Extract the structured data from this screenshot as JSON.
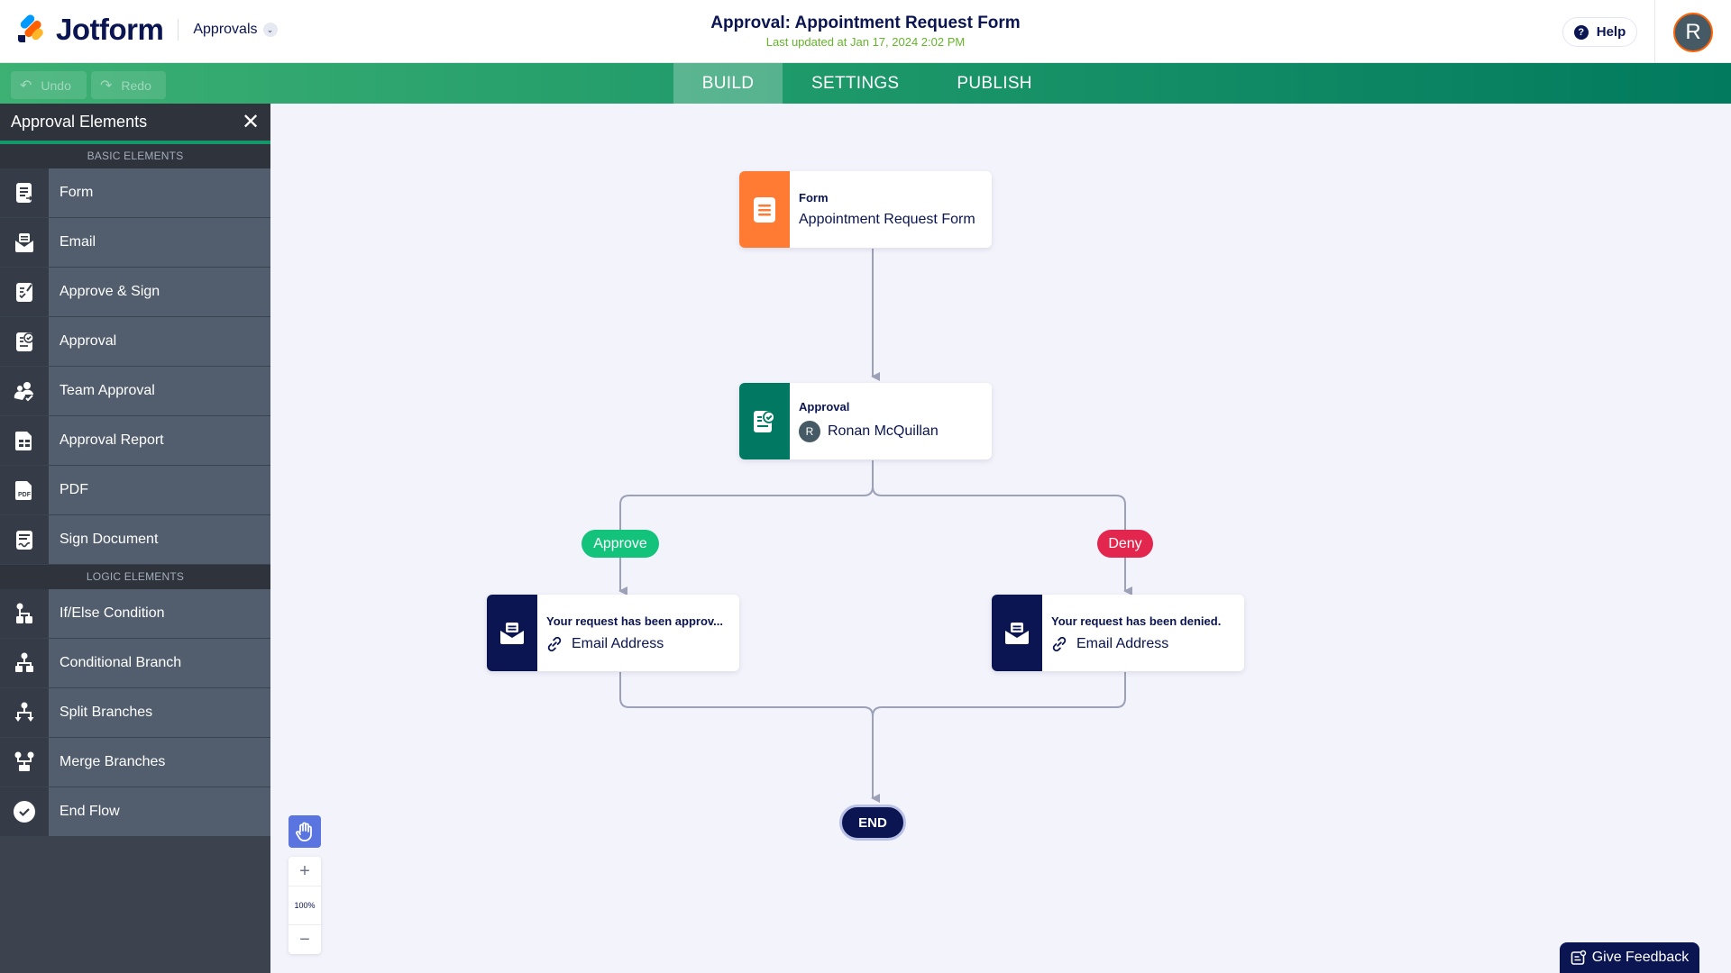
{
  "header": {
    "brand": "Jotform",
    "product": "Approvals",
    "title": "Approval: Appointment Request Form",
    "last_updated": "Last updated at Jan 17, 2024 2:02 PM",
    "help_label": "Help",
    "avatar_initial": "R"
  },
  "toolbar": {
    "undo_label": "Undo",
    "redo_label": "Redo"
  },
  "tabs": [
    {
      "label": "BUILD",
      "active": true
    },
    {
      "label": "SETTINGS",
      "active": false
    },
    {
      "label": "PUBLISH",
      "active": false
    }
  ],
  "sidebar": {
    "title": "Approval Elements",
    "close_icon": "close-icon",
    "sections": [
      {
        "title": "BASIC ELEMENTS",
        "items": [
          {
            "label": "Form",
            "icon": "form-icon"
          },
          {
            "label": "Email",
            "icon": "email-icon"
          },
          {
            "label": "Approve & Sign",
            "icon": "approve-sign-icon"
          },
          {
            "label": "Approval",
            "icon": "approval-icon"
          },
          {
            "label": "Team Approval",
            "icon": "team-approval-icon"
          },
          {
            "label": "Approval Report",
            "icon": "approval-report-icon"
          },
          {
            "label": "PDF",
            "icon": "pdf-icon"
          },
          {
            "label": "Sign Document",
            "icon": "sign-document-icon"
          }
        ]
      },
      {
        "title": "LOGIC ELEMENTS",
        "items": [
          {
            "label": "If/Else Condition",
            "icon": "if-else-icon"
          },
          {
            "label": "Conditional Branch",
            "icon": "conditional-branch-icon"
          },
          {
            "label": "Split Branches",
            "icon": "split-branches-icon"
          },
          {
            "label": "Merge Branches",
            "icon": "merge-branches-icon"
          },
          {
            "label": "End Flow",
            "icon": "end-flow-icon"
          }
        ]
      }
    ]
  },
  "flow": {
    "form_node": {
      "type": "Form",
      "value": "Appointment Request Form",
      "color": "#ff7b34"
    },
    "approval_node": {
      "type": "Approval",
      "assignee": "Ronan McQuillan",
      "assignee_initial": "R",
      "color": "#007862"
    },
    "branches": {
      "approve_label": "Approve",
      "deny_label": "Deny",
      "approve_color": "#13c27b",
      "deny_color": "#e2264d"
    },
    "approve_email": {
      "title": "Your request has been approv...",
      "recipient": "Email Address"
    },
    "deny_email": {
      "title": "Your request has been denied.",
      "recipient": "Email Address"
    },
    "end_label": "END"
  },
  "zoom_control": {
    "zoom_in": "+",
    "level": "100%",
    "zoom_out": "−"
  },
  "feedback_label": "Give Feedback"
}
